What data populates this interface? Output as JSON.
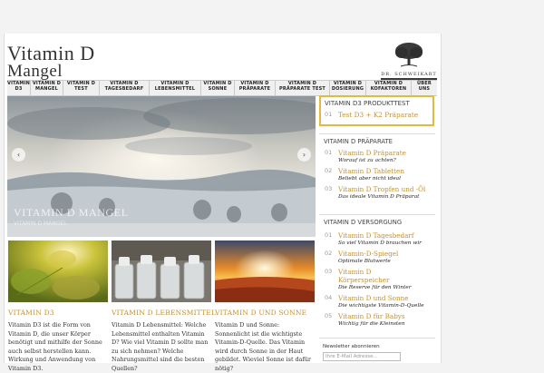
{
  "brand": {
    "line1": "Vitamin D",
    "line2": "Mangel"
  },
  "logo": {
    "text": "DR. SCHWEIKART"
  },
  "nav": [
    {
      "label": "VITAMIN D3"
    },
    {
      "label": "VITAMIN D MANGEL"
    },
    {
      "label": "VITAMIN D TEST"
    },
    {
      "label": "VITAMIN D TAGESBEDARF"
    },
    {
      "label": "VITAMIN D LEBENSMITTEL"
    },
    {
      "label": "VITAMIN D SONNE"
    },
    {
      "label": "VITAMIN D PRÄPARATE"
    },
    {
      "label": "VITAMIN D PRÄPARATE TEST"
    },
    {
      "label": "VITAMIN D DOSIERUNG"
    },
    {
      "label": "VITAMIN D KOFAKTOREN"
    },
    {
      "label": "ÜBER UNS"
    }
  ],
  "hero": {
    "caption": "VITAMIN D MANGEL",
    "sub": "VITAMIN D MANGEL",
    "prev": "‹",
    "next": "›"
  },
  "cards": [
    {
      "title": "VITAMIN D3",
      "text": "Vitamin D3 ist die Form von Vitamin D, die unser Körper benötigt und mithilfe der Sonne auch selbst herstellen kann. Wirkung und Anwendung von Vitamin D3."
    },
    {
      "title": "VITAMIN D LEBENSMITTEL",
      "text": "Vitamin D Lebensmittel: Welche Lebensmittel enthalten Vitamin D? Wie viel Vitamin D sollte man zu sich nehmen? Welche Nahrungsmittel sind die besten Quellen?"
    },
    {
      "title": "VITAMIN D UND SONNE",
      "text": "Vitamin D und Sonne: Sonnenlicht ist die wichtigste Vitamin-D-Quelle. Das Vitamin wird durch Sonne in der Haut gebildet. Wieviel Sonne ist dafür nötig?"
    }
  ],
  "sidebar": {
    "test": {
      "heading": "VITAMIN D3 PRODUKTTEST",
      "num": "01",
      "item": "Test D3 + K2 Präparate"
    },
    "praeparate": {
      "heading": "VITAMIN D PRÄPARATE",
      "items": [
        {
          "num": "01",
          "title": "Vitamin D Präparate",
          "sub": "Worauf ist zu achten?"
        },
        {
          "num": "02",
          "title": "Vitamin D Tabletten",
          "sub": "Beliebt aber nicht ideal"
        },
        {
          "num": "03",
          "title": "Vitamin D Tropfen und -Öl",
          "sub": "Das ideale Vitamin D Präparat"
        }
      ]
    },
    "versorgung": {
      "heading": "VITAMIN D VERSORGUNG",
      "items": [
        {
          "num": "01",
          "title": "Vitamin D Tagesbedarf",
          "sub": "So viel Vitamin D brauchen wir"
        },
        {
          "num": "02",
          "title": "Vitamin-D-Spiegel",
          "sub": "Optimale Blutwerte"
        },
        {
          "num": "03",
          "title": "Vitamin D Körperspeicher",
          "sub": "Die Reserve für den Winter"
        },
        {
          "num": "04",
          "title": "Vitamin D und Sonne",
          "sub": "Die wichtigste Vitamin-D-Quelle"
        },
        {
          "num": "05",
          "title": "Vitamin D für Babys",
          "sub": "Wichtig für die Kleinsten"
        }
      ]
    },
    "newsletter": {
      "heading": "Newsletter abonnieren",
      "placeholder": "Ihre E-Mail Adresse..."
    }
  },
  "colors": {
    "accent": "#c8902a",
    "highlight_border": "#e6b83b"
  }
}
